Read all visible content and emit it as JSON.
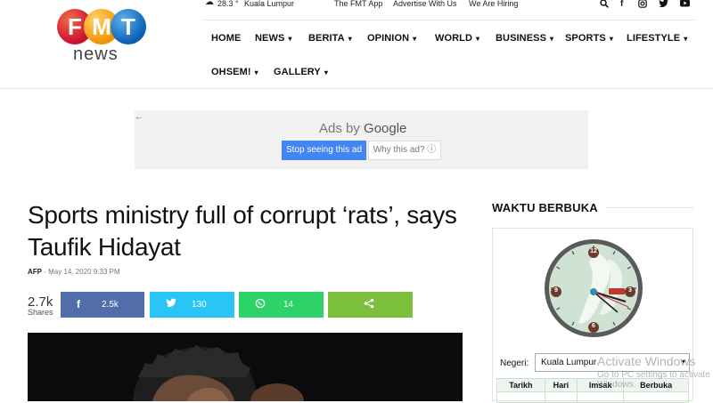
{
  "logo": {
    "letters": [
      "F",
      "M",
      "T"
    ],
    "wordmark": "news"
  },
  "topbar": {
    "temperature": "28.3",
    "city": "Kuala Lumpur",
    "links": [
      "The FMT App",
      "Advertise With Us",
      "We Are Hiring"
    ],
    "icons": [
      "search-icon",
      "facebook-icon",
      "instagram-icon",
      "twitter-icon",
      "youtube-icon"
    ]
  },
  "nav": {
    "items": [
      {
        "label": "HOME",
        "has_menu": false
      },
      {
        "label": "NEWS",
        "has_menu": true
      },
      {
        "label": "BERITA",
        "has_menu": true
      },
      {
        "label": "OPINION",
        "has_menu": true
      },
      {
        "label": "WORLD",
        "has_menu": true
      },
      {
        "label": "BUSINESS",
        "has_menu": true
      },
      {
        "label": "SPORTS",
        "has_menu": true
      },
      {
        "label": "LIFESTYLE",
        "has_menu": true
      },
      {
        "label": "OHSEM!",
        "has_menu": true
      },
      {
        "label": "GALLERY",
        "has_menu": true
      }
    ]
  },
  "ad": {
    "brand_prefix": "Ads by",
    "brand": "Google",
    "stop_label": "Stop seeing this ad",
    "why_label": "Why this ad? ⓘ"
  },
  "article": {
    "title": "Sports ministry full of corrupt ‘rats’, says Taufik Hidayat",
    "author": "AFP",
    "date": "May 14, 2020 9:33 PM"
  },
  "share": {
    "total": "2.7k",
    "total_label": "Shares",
    "facebook": "2.5k",
    "twitter": "130",
    "whatsapp": "14"
  },
  "sidebar": {
    "heading": "WAKTU BERBUKA",
    "clock_numbers": [
      "12",
      "3",
      "6",
      "9"
    ],
    "negeri_label": "Negeri:",
    "negeri_value": "Kuala Lumpur",
    "table_headers": [
      "Tarikh",
      "Hari",
      "Imsak",
      "Berbuka"
    ]
  },
  "overlay": {
    "activate_title": "Activate Windows",
    "activate_sub": "Go to PC settings to activate Windows."
  },
  "colors": {
    "facebook": "#516eab",
    "twitter": "#29c5f6",
    "whatsapp": "#2ed368",
    "share": "#7bbf3a",
    "ad_button": "#4285f4"
  }
}
